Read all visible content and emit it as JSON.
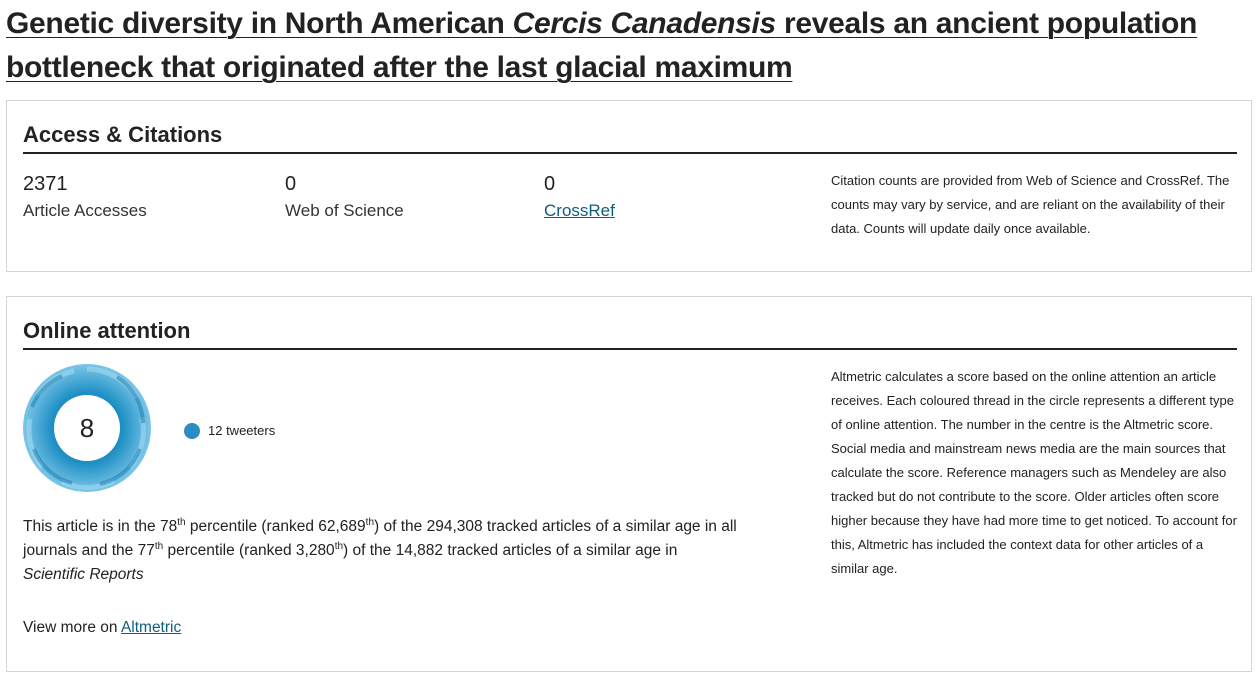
{
  "article": {
    "title_part1": "Genetic diversity in North American ",
    "title_italic": "Cercis Canadensis",
    "title_part2": " reveals an ancient population bottleneck that originated after the last glacial maximum"
  },
  "access_citations": {
    "heading": "Access & Citations",
    "metrics": [
      {
        "value": "2371",
        "label": "Article Accesses"
      },
      {
        "value": "0",
        "label": "Web of Science"
      },
      {
        "value": "0",
        "label": "CrossRef"
      }
    ],
    "note": "Citation counts are provided from Web of Science and CrossRef. The counts may vary by service, and are reliant on the availability of their data. Counts will update daily once available."
  },
  "online_attention": {
    "heading": "Online attention",
    "score": "8",
    "legend": {
      "label": "12 tweeters",
      "color": "#2a8cc0"
    },
    "percentile": {
      "t1": "This article is in the ",
      "p1": "78",
      "s1": "th",
      "t2": " percentile (ranked ",
      "r1": "62,689",
      "s2": "th",
      "t3": ") of the ",
      "total1": "294,308",
      "t4": " tracked articles of a similar age in all journals and the ",
      "p2": "77",
      "s3": "th",
      "t5": " percentile (ranked ",
      "r2": "3,280",
      "s4": "th",
      "t6": ") of the ",
      "total2": "14,882",
      "t7": " tracked articles of a similar age in ",
      "journal": "Scientific Reports"
    },
    "view_more_prefix": "View more on ",
    "view_more_link": "Altmetric",
    "note": "Altmetric calculates a score based on the online attention an article receives. Each coloured thread in the circle represents a different type of online attention. The number in the centre is the Altmetric score. Social media and mainstream news media are the main sources that calculate the score. Reference managers such as Mendeley are also tracked but do not contribute to the score. Older articles often score higher because they have had more time to get noticed. To account for this, Altmetric has included the context data for other articles of a similar age."
  }
}
